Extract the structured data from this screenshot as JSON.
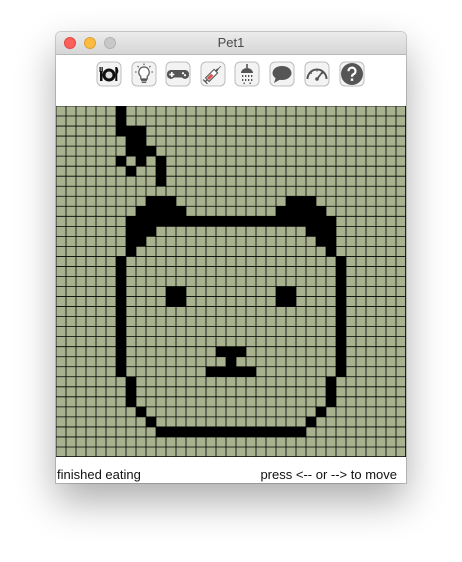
{
  "window": {
    "title": "Pet1"
  },
  "toolbar": {
    "buttons": [
      {
        "icon": "fork-plate-knife-icon"
      },
      {
        "icon": "lightbulb-icon"
      },
      {
        "icon": "gamepad-icon"
      },
      {
        "icon": "syringe-icon"
      },
      {
        "icon": "shower-icon"
      },
      {
        "icon": "speech-bubble-icon"
      },
      {
        "icon": "gauge-icon"
      },
      {
        "icon": "help-icon"
      }
    ]
  },
  "screen": {
    "columns": 35,
    "rows": 35,
    "background_color": "#a8b28e",
    "grid_line_color": "#000000",
    "pixel_color": "#000000",
    "filled_cells": [
      [
        6,
        0
      ],
      [
        6,
        1
      ],
      [
        6,
        2
      ],
      [
        7,
        2
      ],
      [
        7,
        3
      ],
      [
        8,
        2
      ],
      [
        8,
        3
      ],
      [
        6,
        5
      ],
      [
        7,
        4
      ],
      [
        8,
        4
      ],
      [
        9,
        4
      ],
      [
        7,
        6
      ],
      [
        8,
        5
      ],
      [
        10,
        5
      ],
      [
        10,
        6
      ],
      [
        10,
        7
      ],
      [
        9,
        9
      ],
      [
        10,
        9
      ],
      [
        11,
        9
      ],
      [
        8,
        10
      ],
      [
        9,
        10
      ],
      [
        10,
        10
      ],
      [
        11,
        10
      ],
      [
        12,
        10
      ],
      [
        23,
        9
      ],
      [
        24,
        9
      ],
      [
        25,
        9
      ],
      [
        22,
        10
      ],
      [
        23,
        10
      ],
      [
        24,
        10
      ],
      [
        25,
        10
      ],
      [
        26,
        10
      ],
      [
        7,
        11
      ],
      [
        8,
        11
      ],
      [
        9,
        11
      ],
      [
        10,
        11
      ],
      [
        11,
        11
      ],
      [
        12,
        11
      ],
      [
        13,
        11
      ],
      [
        14,
        11
      ],
      [
        15,
        11
      ],
      [
        16,
        11
      ],
      [
        17,
        11
      ],
      [
        18,
        11
      ],
      [
        19,
        11
      ],
      [
        20,
        11
      ],
      [
        21,
        11
      ],
      [
        22,
        11
      ],
      [
        23,
        11
      ],
      [
        24,
        11
      ],
      [
        25,
        11
      ],
      [
        26,
        11
      ],
      [
        27,
        11
      ],
      [
        7,
        12
      ],
      [
        8,
        12
      ],
      [
        9,
        12
      ],
      [
        25,
        12
      ],
      [
        26,
        12
      ],
      [
        27,
        12
      ],
      [
        7,
        13
      ],
      [
        8,
        13
      ],
      [
        26,
        13
      ],
      [
        27,
        13
      ],
      [
        7,
        14
      ],
      [
        27,
        14
      ],
      [
        6,
        15
      ],
      [
        28,
        15
      ],
      [
        6,
        16
      ],
      [
        28,
        16
      ],
      [
        6,
        17
      ],
      [
        28,
        17
      ],
      [
        6,
        18
      ],
      [
        28,
        18
      ],
      [
        6,
        19
      ],
      [
        28,
        19
      ],
      [
        6,
        20
      ],
      [
        28,
        20
      ],
      [
        6,
        21
      ],
      [
        28,
        21
      ],
      [
        6,
        22
      ],
      [
        28,
        22
      ],
      [
        6,
        23
      ],
      [
        28,
        23
      ],
      [
        6,
        24
      ],
      [
        28,
        24
      ],
      [
        6,
        25
      ],
      [
        28,
        25
      ],
      [
        6,
        26
      ],
      [
        28,
        26
      ],
      [
        7,
        27
      ],
      [
        27,
        27
      ],
      [
        7,
        28
      ],
      [
        27,
        28
      ],
      [
        7,
        29
      ],
      [
        27,
        29
      ],
      [
        8,
        30
      ],
      [
        26,
        30
      ],
      [
        9,
        31
      ],
      [
        25,
        31
      ],
      [
        10,
        32
      ],
      [
        11,
        32
      ],
      [
        12,
        32
      ],
      [
        13,
        32
      ],
      [
        14,
        32
      ],
      [
        15,
        32
      ],
      [
        16,
        32
      ],
      [
        17,
        32
      ],
      [
        18,
        32
      ],
      [
        19,
        32
      ],
      [
        20,
        32
      ],
      [
        21,
        32
      ],
      [
        22,
        32
      ],
      [
        23,
        32
      ],
      [
        24,
        32
      ],
      [
        11,
        18
      ],
      [
        12,
        18
      ],
      [
        11,
        19
      ],
      [
        12,
        19
      ],
      [
        22,
        18
      ],
      [
        23,
        18
      ],
      [
        22,
        19
      ],
      [
        23,
        19
      ],
      [
        16,
        24
      ],
      [
        17,
        24
      ],
      [
        18,
        24
      ],
      [
        17,
        25
      ],
      [
        15,
        26
      ],
      [
        16,
        26
      ],
      [
        17,
        26
      ],
      [
        18,
        26
      ],
      [
        19,
        26
      ]
    ]
  },
  "status": {
    "message": "finished eating",
    "hint": "press <-- or --> to move"
  }
}
